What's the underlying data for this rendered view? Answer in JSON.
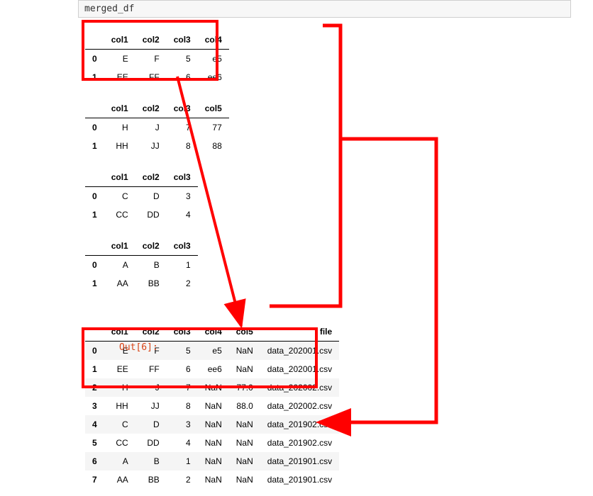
{
  "code_cell": "merged_df",
  "out_prompt": "Out[6]:",
  "tables": {
    "t4": {
      "headers": [
        "col1",
        "col2",
        "col3",
        "col4"
      ],
      "rows": [
        {
          "idx": "0",
          "cells": [
            "E",
            "F",
            "5",
            "e5"
          ]
        },
        {
          "idx": "1",
          "cells": [
            "EE",
            "FF",
            "6",
            "ee6"
          ]
        }
      ]
    },
    "t5": {
      "headers": [
        "col1",
        "col2",
        "col3",
        "col5"
      ],
      "rows": [
        {
          "idx": "0",
          "cells": [
            "H",
            "J",
            "7",
            "77"
          ]
        },
        {
          "idx": "1",
          "cells": [
            "HH",
            "JJ",
            "8",
            "88"
          ]
        }
      ]
    },
    "t3a": {
      "headers": [
        "col1",
        "col2",
        "col3"
      ],
      "rows": [
        {
          "idx": "0",
          "cells": [
            "C",
            "D",
            "3"
          ]
        },
        {
          "idx": "1",
          "cells": [
            "CC",
            "DD",
            "4"
          ]
        }
      ]
    },
    "t3b": {
      "headers": [
        "col1",
        "col2",
        "col3"
      ],
      "rows": [
        {
          "idx": "0",
          "cells": [
            "A",
            "B",
            "1"
          ]
        },
        {
          "idx": "1",
          "cells": [
            "AA",
            "BB",
            "2"
          ]
        }
      ]
    },
    "merged": {
      "headers": [
        "col1",
        "col2",
        "col3",
        "col4",
        "col5",
        "file"
      ],
      "rows": [
        {
          "idx": "0",
          "cells": [
            "E",
            "F",
            "5",
            "e5",
            "NaN",
            "data_202001.csv"
          ]
        },
        {
          "idx": "1",
          "cells": [
            "EE",
            "FF",
            "6",
            "ee6",
            "NaN",
            "data_202001.csv"
          ]
        },
        {
          "idx": "2",
          "cells": [
            "H",
            "J",
            "7",
            "NaN",
            "77.0",
            "data_202002.csv"
          ]
        },
        {
          "idx": "3",
          "cells": [
            "HH",
            "JJ",
            "8",
            "NaN",
            "88.0",
            "data_202002.csv"
          ]
        },
        {
          "idx": "4",
          "cells": [
            "C",
            "D",
            "3",
            "NaN",
            "NaN",
            "data_201902.csv"
          ]
        },
        {
          "idx": "5",
          "cells": [
            "CC",
            "DD",
            "4",
            "NaN",
            "NaN",
            "data_201902.csv"
          ]
        },
        {
          "idx": "6",
          "cells": [
            "A",
            "B",
            "1",
            "NaN",
            "NaN",
            "data_201901.csv"
          ]
        },
        {
          "idx": "7",
          "cells": [
            "AA",
            "BB",
            "2",
            "NaN",
            "NaN",
            "data_201901.csv"
          ]
        }
      ]
    }
  }
}
